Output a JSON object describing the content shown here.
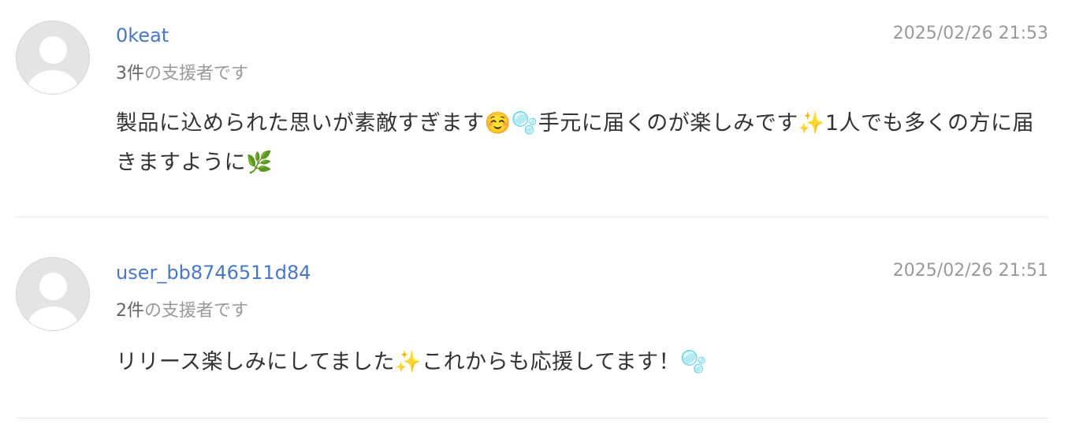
{
  "comments": [
    {
      "username": "0keat",
      "timestamp": "2025/02/26 21:53",
      "support_count": "3件",
      "support_suffix": "の支援者です",
      "message": "製品に込められた思いが素敵すぎます☺️🫧手元に届くのが楽しみです✨1人でも多くの方に届きますように🌿"
    },
    {
      "username": "user_bb8746511d84",
      "timestamp": "2025/02/26 21:51",
      "support_count": "2件",
      "support_suffix": "の支援者です",
      "message": "リリース楽しみにしてました✨これからも応援してます！🫧"
    }
  ],
  "icons": {
    "avatar": "default-user-avatar-icon"
  },
  "colors": {
    "username_link": "#4a78c8",
    "muted_text": "#999999",
    "body_text": "#333333"
  }
}
